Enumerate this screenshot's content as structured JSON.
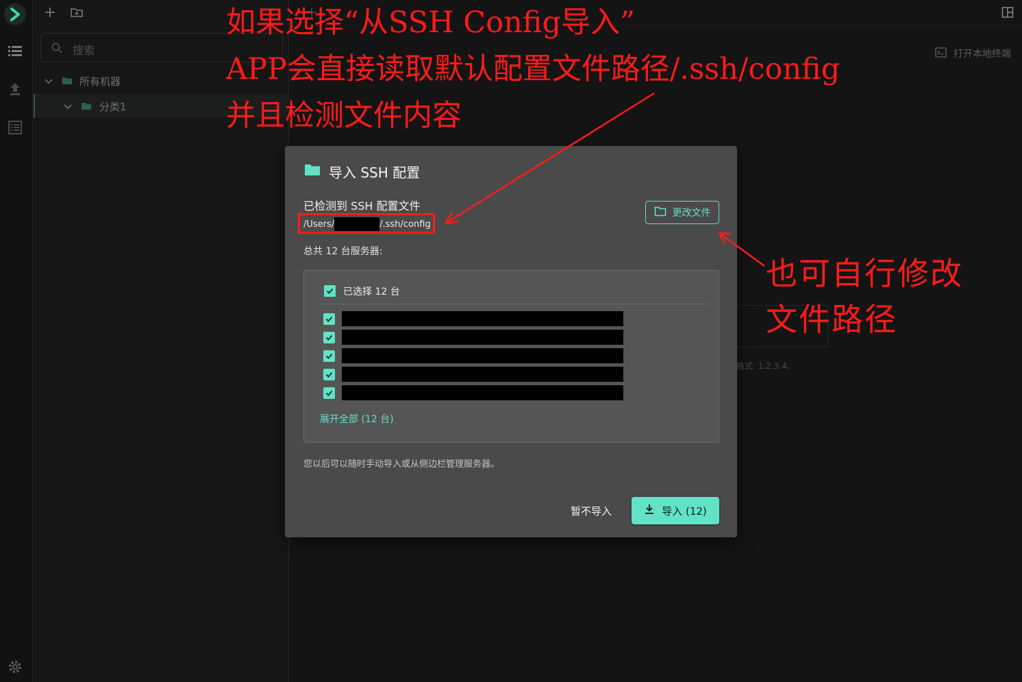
{
  "sidebar": {
    "search_placeholder": "搜索",
    "tree": {
      "root_label": "所有机器",
      "child_label": "分类1"
    }
  },
  "main": {
    "local_terminal_label": "打开本地终端",
    "ghost_hint": "格式: 1.2.3.4,"
  },
  "modal": {
    "title": "导入 SSH 配置",
    "detected_label": "已检测到 SSH 配置文件",
    "path_prefix": "/Users/",
    "path_suffix": "/.ssh/config",
    "change_file_label": "更改文件",
    "total_label": "总共 12 台服务器:",
    "selected_label": "已选择 12 台",
    "expand_label": "展开全部 (12 台)",
    "note": "您以后可以随时手动导入或从侧边栏管理服务器。",
    "skip_label": "暂不导入",
    "import_label": "导入 (12)"
  },
  "annotations": {
    "line1": "如果选择“从SSH Config导入”",
    "line2": "APP会直接读取默认配置文件路径/.ssh/config",
    "line3": "并且检测文件内容",
    "line4": "也可自行修改",
    "line5": "文件路径"
  },
  "colors": {
    "accent": "#62e2c6",
    "annotation": "#ff1b1b",
    "modal_bg": "#4a4a4a"
  }
}
